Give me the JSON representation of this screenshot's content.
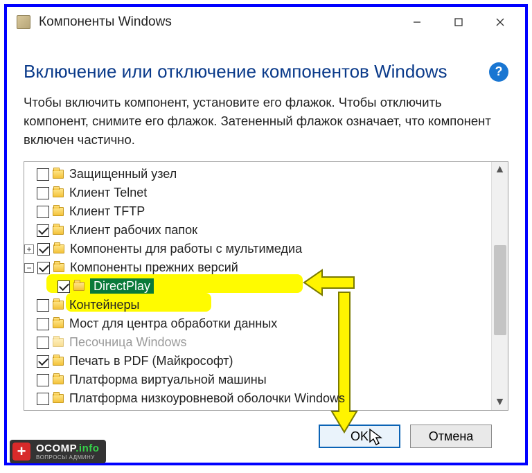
{
  "window": {
    "title": "Компоненты Windows"
  },
  "heading": "Включение или отключение компонентов Windows",
  "instructions": "Чтобы включить компонент, установите его флажок. Чтобы отключить компонент, снимите его флажок. Затененный флажок означает, что компонент включен частично.",
  "tree": {
    "items": [
      {
        "label": "Защищенный узел",
        "checked": false,
        "indent": 1,
        "expander": "",
        "disabled": false,
        "highlight": ""
      },
      {
        "label": "Клиент Telnet",
        "checked": false,
        "indent": 1,
        "expander": "",
        "disabled": false,
        "highlight": ""
      },
      {
        "label": "Клиент TFTP",
        "checked": false,
        "indent": 1,
        "expander": "",
        "disabled": false,
        "highlight": ""
      },
      {
        "label": "Клиент рабочих папок",
        "checked": true,
        "indent": 1,
        "expander": "",
        "disabled": false,
        "highlight": ""
      },
      {
        "label": "Компоненты для работы с мультимедиа",
        "checked": true,
        "indent": 1,
        "expander": "+",
        "disabled": false,
        "highlight": ""
      },
      {
        "label": "Компоненты прежних версий",
        "checked": true,
        "indent": 1,
        "expander": "-",
        "disabled": false,
        "highlight": "parent"
      },
      {
        "label": "DirectPlay",
        "checked": true,
        "indent": 2,
        "expander": "",
        "disabled": false,
        "highlight": "child"
      },
      {
        "label": "Контейнеры",
        "checked": false,
        "indent": 1,
        "expander": "",
        "disabled": false,
        "highlight": ""
      },
      {
        "label": "Мост для центра обработки данных",
        "checked": false,
        "indent": 1,
        "expander": "",
        "disabled": false,
        "highlight": ""
      },
      {
        "label": "Песочница Windows",
        "checked": false,
        "indent": 1,
        "expander": "",
        "disabled": true,
        "highlight": ""
      },
      {
        "label": "Печать в PDF (Майкрософт)",
        "checked": true,
        "indent": 1,
        "expander": "",
        "disabled": false,
        "highlight": ""
      },
      {
        "label": "Платформа виртуальной машины",
        "checked": false,
        "indent": 1,
        "expander": "",
        "disabled": false,
        "highlight": ""
      },
      {
        "label": "Платформа низкоуровневой оболочки Windows",
        "checked": false,
        "indent": 1,
        "expander": "",
        "disabled": false,
        "highlight": ""
      }
    ]
  },
  "buttons": {
    "ok": "OK",
    "cancel": "Отмена"
  },
  "watermark": {
    "brand": "OCOMP",
    "suffix": ".info",
    "sub": "ВОПРОСЫ АДМИНУ"
  }
}
